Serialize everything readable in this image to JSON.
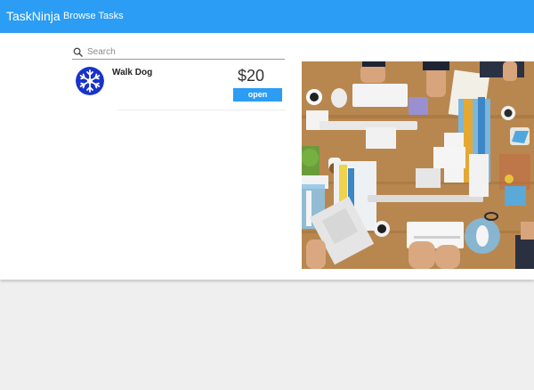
{
  "header": {
    "brand": "TaskNinja",
    "nav_browse": "Browse Tasks",
    "color": "#2b9df4"
  },
  "search": {
    "placeholder": "Search",
    "value": "",
    "icon": "search-icon"
  },
  "tasks": [
    {
      "title": "Walk Dog",
      "price": "$20",
      "status": "open",
      "avatar_icon": "snowflake-icon",
      "avatar_color": "#1833c8"
    }
  ],
  "hero": {
    "description_icon": "office-desk-photo"
  }
}
